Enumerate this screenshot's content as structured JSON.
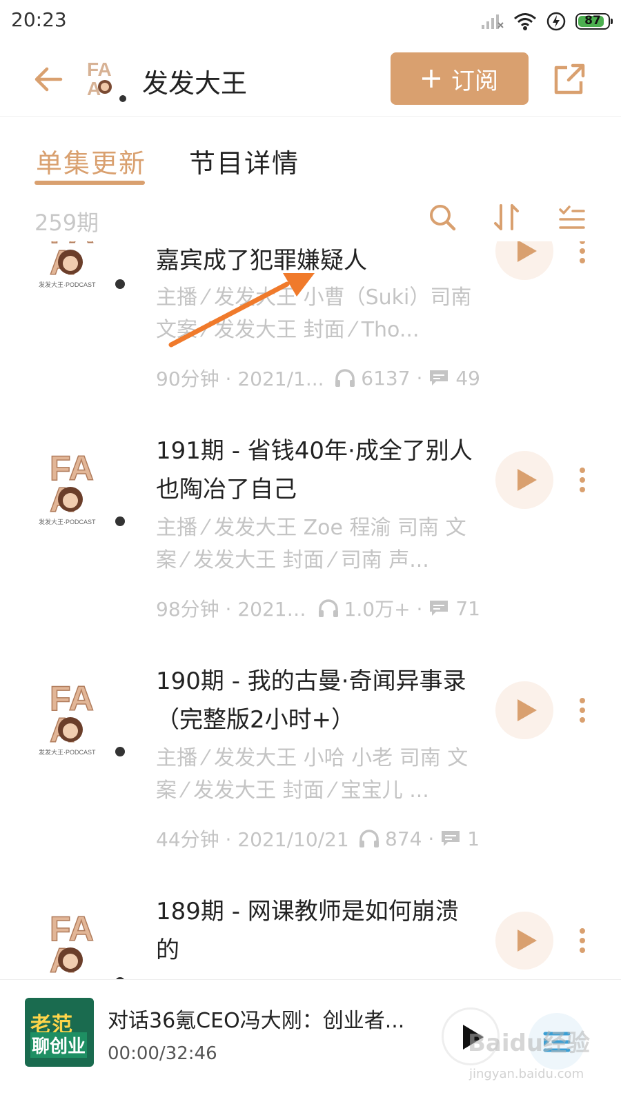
{
  "status_bar": {
    "time": "20:23",
    "battery_level": 87,
    "battery_text": "87"
  },
  "header": {
    "title": "发发大王",
    "subscribe_label": "订阅",
    "accent_color": "#d9a06f"
  },
  "tabs": [
    {
      "label": "单集更新",
      "active": true
    },
    {
      "label": "节目详情",
      "active": false
    }
  ],
  "toolbar": {
    "episode_count": "259期"
  },
  "episodes": [
    {
      "title": "嘉宾成了犯罪嫌疑人",
      "hosts": "主播 ⁄ 发发大王 小曹（Suki）司南 文案 ⁄ 发发大王 封面 ⁄ Tho...",
      "duration_date": "90分钟 · 2021/1...",
      "plays": "6137 ·",
      "comments": "49"
    },
    {
      "title": "191期 - 省钱40年·成全了别人也陶冶了自己",
      "hosts": "主播 ⁄ 发发大王 Zoe 程渝 司南 文案 ⁄ 发发大王 封面 ⁄ 司南 声...",
      "duration_date": "98分钟 · 2021/...",
      "plays": "1.0万+ ·",
      "comments": "71"
    },
    {
      "title": "190期 - 我的古曼·奇闻异事录（完整版2小时+）",
      "hosts": "主播 ⁄ 发发大王 小哈 小老 司南 文案 ⁄ 发发大王 封面 ⁄ 宝宝儿 ...",
      "duration_date": "44分钟 · 2021/10/21",
      "plays": "874 ·",
      "comments": "1"
    },
    {
      "title": "189期 - 网课教师是如何崩溃的",
      "hosts": "",
      "duration_date": "",
      "plays": "",
      "comments": ""
    }
  ],
  "thumbnail": {
    "logo_top": "FA",
    "logo_bottom": "A",
    "caption": "发发大王·PODCAST"
  },
  "player": {
    "cover_line1": "老范",
    "cover_line2": "聊创业",
    "title": "对话36氪CEO冯大刚：创业者...",
    "time": "00:00/32:46"
  },
  "watermark": {
    "text": "Baidu经验",
    "url": "jingyan.baidu.com"
  }
}
